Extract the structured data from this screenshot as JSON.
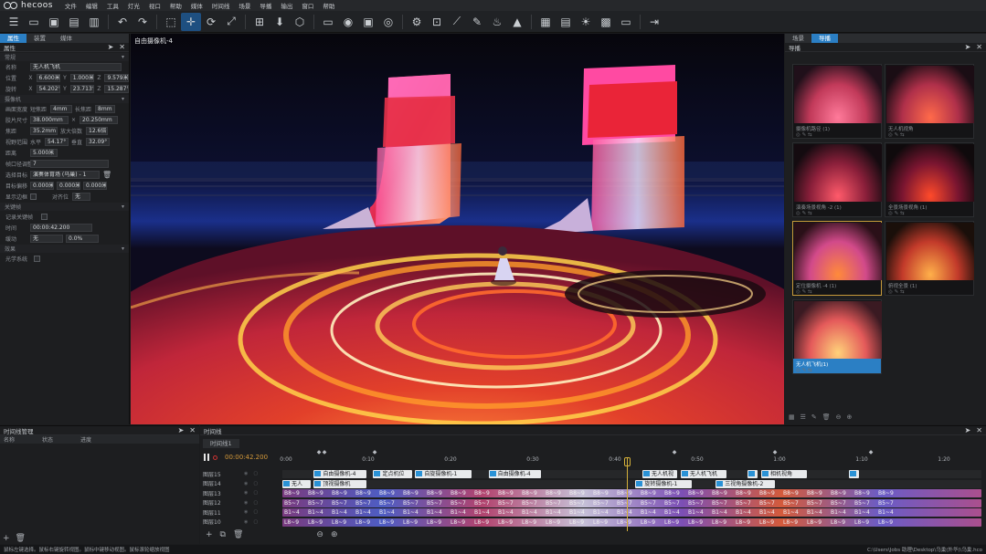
{
  "app": {
    "logo": "hecoos",
    "brand_right": "hecoos"
  },
  "menu": [
    "文件",
    "编辑",
    "工具",
    "灯光",
    "视口",
    "帮助",
    "媒体",
    "时间线",
    "场景",
    "导播",
    "输出",
    "窗口",
    "帮助"
  ],
  "toolbar_icons": [
    "menu-icon",
    "new-file-icon",
    "save-icon",
    "save-as-icon",
    "print-icon",
    "undo-icon",
    "redo-icon",
    "select-icon",
    "move-icon",
    "rotate-icon",
    "scale-icon",
    "snap-icon",
    "render-icon",
    "cube-icon",
    "display-icon",
    "eye-icon",
    "monitor-icon",
    "camera-icon",
    "gear-icon",
    "frame-icon",
    "ruler-icon",
    "brush-icon",
    "fire-icon",
    "rocket-icon",
    "grid-icon",
    "panel-icon",
    "sun-icon",
    "calendar-icon",
    "screen-icon",
    "export-icon"
  ],
  "left_panel": {
    "tabs": [
      "属性",
      "装置",
      "媒体"
    ],
    "title": "属性",
    "sections": {
      "basic": "常规",
      "camera": "摄像机",
      "keyframe": "关键帧",
      "effect": "效果"
    },
    "name_label": "名称",
    "name_value": "无人机飞机",
    "position_label": "位置",
    "position": {
      "x": "6.600米",
      "y": "1.000米",
      "z": "9.579米"
    },
    "rotation_label": "旋转",
    "rotation": {
      "x": "54.202°",
      "y": "23.713°",
      "z": "15.287°"
    },
    "sensor_label": "画面宽度",
    "sensor_a_label": "短焦距",
    "sensor_a": "4mm",
    "sensor_b_label": "长焦距",
    "sensor_b": "8mm",
    "frame_size_label": "胶片尺寸",
    "frame_w": "38.000mm",
    "frame_h": "20.250mm",
    "focal_label": "焦距",
    "focal_value": "35.2mm",
    "zoom_label": "放大倍数",
    "zoom_value": "12.6倍",
    "fov_label": "视野范围",
    "fov_h_label": "水平",
    "fov_h": "54.17°",
    "fov_v_label": "垂直",
    "fov_v": "32.09°",
    "distance_label": "距离",
    "distance_value": "5.000米",
    "index_label": "帧口径调整",
    "index_value": "7",
    "target_label": "选择目标",
    "target_value": "演奏体育场 (乌巢) - 1",
    "offset_label": "目标偏移",
    "offset_x": "0.000米",
    "offset_y": "0.000米",
    "offset_z": "0.000米",
    "show_frame_label": "显示边框",
    "link_label": "对齐位",
    "link_value": "无",
    "record_label": "记录关键帧",
    "time_label": "时间",
    "time_value": "00:00:42.200",
    "ease_label": "缓动",
    "ease_value": "无",
    "ease_pct": "0.0%",
    "effect_label": "光学系统"
  },
  "viewport": {
    "title": "自由摄像机-4"
  },
  "right_panel": {
    "tabs": [
      "场景",
      "导播"
    ],
    "title": "导播",
    "thumbnails": [
      {
        "caption": "摄像机路径 (1)"
      },
      {
        "caption": "无人机视角"
      },
      {
        "caption": "演奏场景视角 -2 (1)"
      },
      {
        "caption": "全景场景视角 (1)"
      },
      {
        "caption": "定位摄像机 -4 (1)"
      },
      {
        "caption": "俯视全景 (1)"
      },
      {
        "caption": "无人机飞机(1)"
      }
    ]
  },
  "timeline_manager": {
    "title": "时间线管理",
    "columns": [
      "名称",
      "状态",
      "进度"
    ]
  },
  "timeline": {
    "title": "时间线",
    "tab": "时间线1",
    "current_time": "00:00:42.200",
    "ruler": [
      "0:00",
      "0:10",
      "0:20",
      "0:30",
      "0:40",
      "0:50",
      "1:00",
      "1:10",
      "1:20"
    ],
    "tracks": [
      {
        "name": "图层15",
        "clips": [
          {
            "label": "自由摄像机-4",
            "kind": "cam",
            "start": 0.045,
            "end": 0.12
          },
          {
            "label": "定点机位",
            "kind": "cam",
            "start": 0.13,
            "end": 0.185
          },
          {
            "label": "自旋摄像机-1",
            "kind": "cam",
            "start": 0.19,
            "end": 0.27
          },
          {
            "label": "自由摄像机-4",
            "kind": "cam",
            "start": 0.295,
            "end": 0.37
          },
          {
            "label": "无人机视",
            "kind": "cam",
            "start": 0.515,
            "end": 0.565
          },
          {
            "label": "无人机飞机",
            "kind": "cam",
            "start": 0.57,
            "end": 0.635
          },
          {
            "label": "",
            "kind": "cam",
            "start": 0.665,
            "end": 0.68
          },
          {
            "label": "相机视角",
            "kind": "cam",
            "start": 0.685,
            "end": 0.75
          },
          {
            "label": "",
            "kind": "cam",
            "start": 0.81,
            "end": 0.825
          }
        ]
      },
      {
        "name": "图层14",
        "clips": [
          {
            "label": "无人",
            "kind": "cam",
            "start": 0.0,
            "end": 0.04
          },
          {
            "label": "顶视摄像机",
            "kind": "cam",
            "start": 0.045,
            "end": 0.12
          },
          {
            "label": "旋转摄像机-1",
            "kind": "cam",
            "start": 0.505,
            "end": 0.585
          },
          {
            "label": "三视角摄像机-2",
            "kind": "cam",
            "start": 0.62,
            "end": 0.705
          }
        ]
      },
      {
        "name": "图层13",
        "clips": [
          {
            "label": "B8~9|B8~9|B8~9|B8~9|B8~9|B8~9|B8~9|B8~9|B8~9|B8~9|B8~9|B8~9|B8~9|B8~9|B8~9|B8~9|B8~9|B8~9|B8~9|B8~9|B8~9|B8~9|B8~9|B8~9|B8~9|B8~9",
            "kind": "media",
            "start": 0.0,
            "end": 1.0
          }
        ]
      },
      {
        "name": "图层12",
        "clips": [
          {
            "label": "B5~7|B5~7|B5~7|B5~7|B5~7|B5~7|B5~7|B5~7|B5~7|B5~7|B5~7|B5~7|B5~7|B5~7|B5~7|B5~7|B5~7|B5~7|B5~7|B5~7|B5~7|B5~7|B5~7|B5~7|B5~7|B5~7",
            "kind": "media",
            "start": 0.0,
            "end": 1.0
          }
        ]
      },
      {
        "name": "图层11",
        "clips": [
          {
            "label": "B1~4|B1~4|B1~4|B1~4|B1~4|B1~4|B1~4|B1~4|B1~4|B1~4|B1~4|B1~4|B1~4|B1~4|B1~4|B1~4|B1~4|B1~4|B1~4|B1~4|B1~4|B1~4|B1~4|B1~4|B1~4|B1~4",
            "kind": "media",
            "start": 0.0,
            "end": 1.0
          }
        ]
      },
      {
        "name": "图层10",
        "clips": [
          {
            "label": "L8~9|L8~9|L8~9|L8~9|L8~9|L8~9|L8~9|L8~9|L8~9|L8~9|L8~9|L8~9|L8~9|L8~9|L8~9|L8~9|L8~9|L8~9|L8~9|L8~9|L8~9|L8~9|L8~9|L8~9|L8~9|L8~9",
            "kind": "media",
            "start": 0.0,
            "end": 1.0
          }
        ]
      }
    ]
  },
  "statusbar": {
    "hint": "鼠标左键选择。鼠标右键旋转视图。鼠标中键移动视图。鼠标滚轮缩放视图",
    "path": "C:\\Users\\Jobs 助理\\Desktop\\乌巢(外华)\\乌巢.hco"
  },
  "colors": {
    "accent": "#2b7fc4",
    "playhead": "#d4b03a",
    "time": "#d59a3a"
  }
}
